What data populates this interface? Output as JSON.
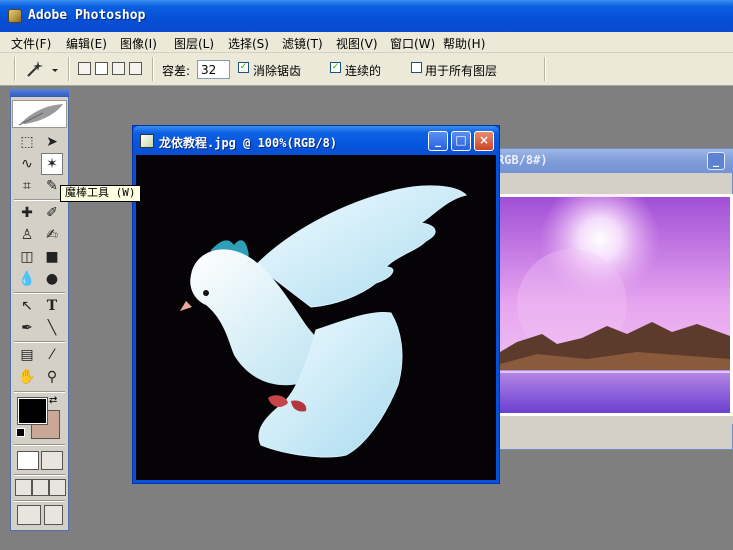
{
  "app": {
    "title": "Adobe Photoshop"
  },
  "menu": [
    "文件(F)",
    "编辑(E)",
    "图像(I)",
    "图层(L)",
    "选择(S)",
    "滤镜(T)",
    "视图(V)",
    "窗口(W)",
    "帮助(H)"
  ],
  "options": {
    "tolerance_label": "容差:",
    "tolerance_value": "32",
    "anti_alias_label": "消除锯齿",
    "anti_alias_checked": true,
    "contiguous_label": "连续的",
    "contiguous_checked": true,
    "all_layers_label": "用于所有图层",
    "all_layers_checked": false
  },
  "toolbox": {
    "icons": [
      "marquee-icon",
      "move-icon",
      "lasso-icon",
      "magic-wand-icon",
      "crop-icon",
      "slice-icon",
      "healing-brush-icon",
      "brush-icon",
      "clone-stamp-icon",
      "history-brush-icon",
      "eraser-icon",
      "gradient-icon",
      "blur-icon",
      "dodge-icon",
      "path-select-icon",
      "type-icon",
      "pen-icon",
      "line-icon",
      "notes-icon",
      "eyedropper-icon",
      "hand-icon",
      "zoom-icon"
    ],
    "tooltip": "魔棒工具 (W)",
    "foreground_color": "#000000",
    "background_color": "#c9a897"
  },
  "documents": {
    "front": {
      "title": "龙依教程.jpg @ 100%(RGB/8)",
      "min": "_",
      "max": "□",
      "close": "×"
    },
    "back": {
      "title_fragment": "RGB/8#)",
      "min": "_"
    }
  }
}
